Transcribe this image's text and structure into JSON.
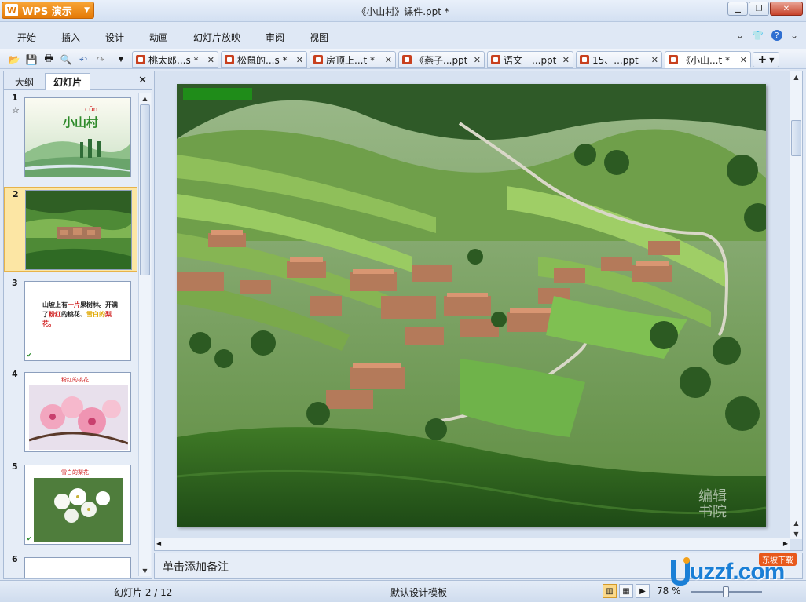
{
  "titlebar": {
    "app_name": "WPS 演示",
    "app_icon": "W",
    "window_title": "《小山村》课件.ppt *"
  },
  "menu": {
    "items": [
      "开始",
      "插入",
      "设计",
      "动画",
      "幻灯片放映",
      "审阅",
      "视图"
    ]
  },
  "doc_tabs": [
    {
      "label": "桃太郎...s *"
    },
    {
      "label": "松鼠的...s *"
    },
    {
      "label": "房顶上...t *"
    },
    {
      "label": "《燕子...ppt"
    },
    {
      "label": "语文一...ppt"
    },
    {
      "label": "15、...ppt"
    },
    {
      "label": "《小山...t *"
    }
  ],
  "left_pane": {
    "tab_outline": "大纲",
    "tab_slides": "幻灯片",
    "thumbnails": [
      {
        "num": "1",
        "title": "小山村",
        "pinyin": "cūn"
      },
      {
        "num": "2"
      },
      {
        "num": "3",
        "text_parts": [
          "山坡上有",
          "一片",
          "果树林。开满了",
          "粉红",
          "的桃花、",
          "雪白的",
          "梨花。"
        ]
      },
      {
        "num": "4",
        "caption": "粉红的桃花"
      },
      {
        "num": "5",
        "caption": "雪白的梨花"
      },
      {
        "num": "6"
      }
    ]
  },
  "notes": {
    "placeholder": "单击添加备注"
  },
  "statusbar": {
    "slide_indicator": "幻灯片 2 / 12",
    "template": "默认设计模板",
    "zoom": "78 %"
  },
  "slide": {
    "watermark": "编辑 书院"
  },
  "site_watermark": {
    "main": "uzzf.com",
    "badge": "东坡下载"
  },
  "colors": {
    "accent": "#e57a07",
    "selected_thumb": "#fce6a4",
    "chrome": "#dfe8f5"
  }
}
